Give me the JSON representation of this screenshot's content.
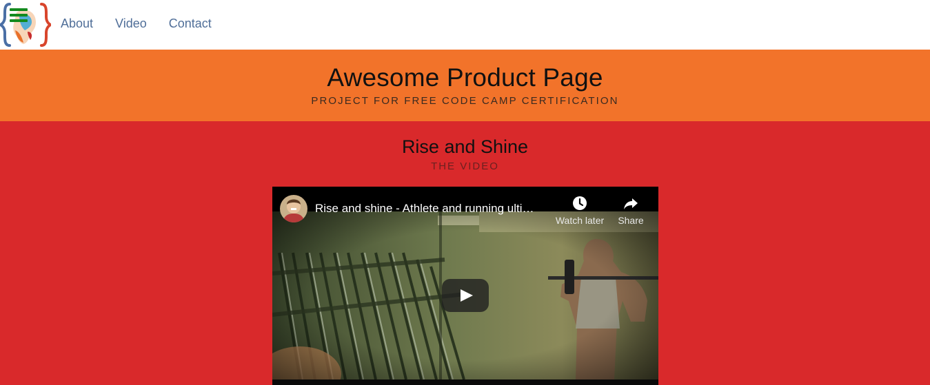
{
  "nav": {
    "logo_alt": "freeCodeCamp logo",
    "links": [
      "About",
      "Video",
      "Contact"
    ]
  },
  "hero": {
    "title": "Awesome Product Page",
    "subtitle": "PROJECT FOR FREE CODE CAMP CERTIFICATION"
  },
  "video_section": {
    "title": "Rise and Shine",
    "subtitle": "THE VIDEO",
    "player": {
      "title": "Rise and shine - Athlete and running ulti…",
      "watch_later_label": "Watch later",
      "share_label": "Share"
    }
  },
  "colors": {
    "nav_bg": "#ffffff",
    "nav_link": "#4f6e98",
    "hero_bg": "#f2732a",
    "section_bg": "#d9292b",
    "player_bg": "#000000"
  },
  "icons": [
    "hamburger-icon",
    "clock-icon",
    "share-arrow-icon",
    "play-icon"
  ]
}
